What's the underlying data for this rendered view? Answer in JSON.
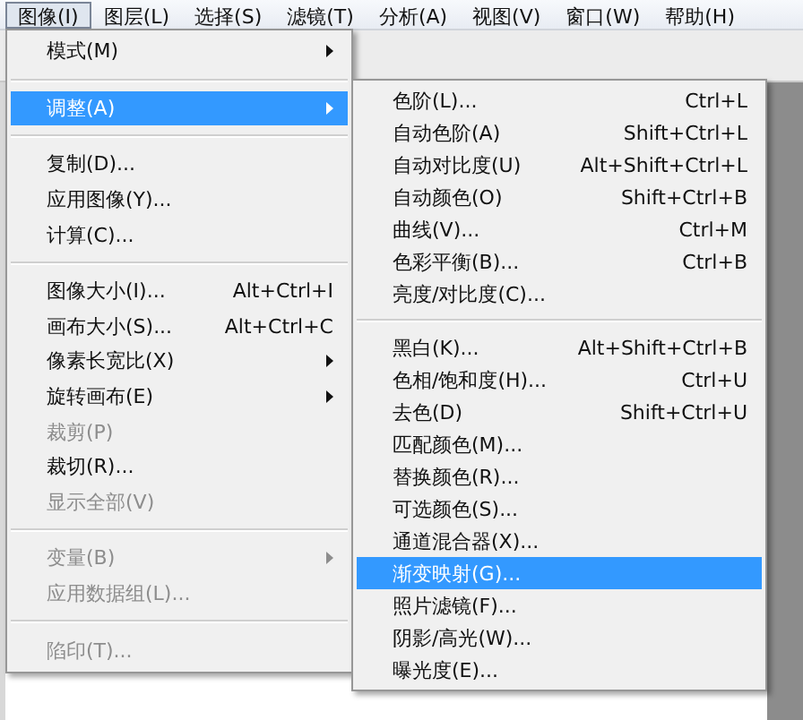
{
  "menubar": [
    {
      "label": "图像(I)",
      "selected": true
    },
    {
      "label": "图层(L)",
      "selected": false
    },
    {
      "label": "选择(S)",
      "selected": false
    },
    {
      "label": "滤镜(T)",
      "selected": false
    },
    {
      "label": "分析(A)",
      "selected": false
    },
    {
      "label": "视图(V)",
      "selected": false
    },
    {
      "label": "窗口(W)",
      "selected": false
    },
    {
      "label": "帮助(H)",
      "selected": false
    }
  ],
  "image_menu": [
    {
      "kind": "item",
      "label": "模式(M)",
      "submenu": true,
      "selected": false,
      "disabled": false
    },
    {
      "kind": "separator"
    },
    {
      "kind": "item",
      "label": "调整(A)",
      "submenu": true,
      "selected": true,
      "disabled": false
    },
    {
      "kind": "separator"
    },
    {
      "kind": "item",
      "label": "复制(D)...",
      "selected": false,
      "disabled": false
    },
    {
      "kind": "item",
      "label": "应用图像(Y)...",
      "selected": false,
      "disabled": false
    },
    {
      "kind": "item",
      "label": "计算(C)...",
      "selected": false,
      "disabled": false
    },
    {
      "kind": "separator"
    },
    {
      "kind": "item",
      "label": "图像大小(I)...",
      "shortcut": "Alt+Ctrl+I",
      "selected": false,
      "disabled": false
    },
    {
      "kind": "item",
      "label": "画布大小(S)...",
      "shortcut": "Alt+Ctrl+C",
      "selected": false,
      "disabled": false
    },
    {
      "kind": "item",
      "label": "像素长宽比(X)",
      "submenu": true,
      "selected": false,
      "disabled": false
    },
    {
      "kind": "item",
      "label": "旋转画布(E)",
      "submenu": true,
      "selected": false,
      "disabled": false
    },
    {
      "kind": "item",
      "label": "裁剪(P)",
      "selected": false,
      "disabled": true
    },
    {
      "kind": "item",
      "label": "裁切(R)...",
      "selected": false,
      "disabled": false
    },
    {
      "kind": "item",
      "label": "显示全部(V)",
      "selected": false,
      "disabled": true
    },
    {
      "kind": "separator"
    },
    {
      "kind": "item",
      "label": "变量(B)",
      "submenu": true,
      "selected": false,
      "disabled": true
    },
    {
      "kind": "item",
      "label": "应用数据组(L)...",
      "selected": false,
      "disabled": true
    },
    {
      "kind": "separator"
    },
    {
      "kind": "item",
      "label": "陷印(T)...",
      "selected": false,
      "disabled": true
    }
  ],
  "adjust_menu": [
    {
      "kind": "item",
      "label": "色阶(L)...",
      "shortcut": "Ctrl+L",
      "selected": false
    },
    {
      "kind": "item",
      "label": "自动色阶(A)",
      "shortcut": "Shift+Ctrl+L",
      "selected": false
    },
    {
      "kind": "item",
      "label": "自动对比度(U)",
      "shortcut": "Alt+Shift+Ctrl+L",
      "selected": false
    },
    {
      "kind": "item",
      "label": "自动颜色(O)",
      "shortcut": "Shift+Ctrl+B",
      "selected": false
    },
    {
      "kind": "item",
      "label": "曲线(V)...",
      "shortcut": "Ctrl+M",
      "selected": false
    },
    {
      "kind": "item",
      "label": "色彩平衡(B)...",
      "shortcut": "Ctrl+B",
      "selected": false
    },
    {
      "kind": "item",
      "label": "亮度/对比度(C)...",
      "selected": false
    },
    {
      "kind": "separator"
    },
    {
      "kind": "item",
      "label": "黑白(K)...",
      "shortcut": "Alt+Shift+Ctrl+B",
      "selected": false
    },
    {
      "kind": "item",
      "label": "色相/饱和度(H)...",
      "shortcut": "Ctrl+U",
      "selected": false
    },
    {
      "kind": "item",
      "label": "去色(D)",
      "shortcut": "Shift+Ctrl+U",
      "selected": false
    },
    {
      "kind": "item",
      "label": "匹配颜色(M)...",
      "selected": false
    },
    {
      "kind": "item",
      "label": "替换颜色(R)...",
      "selected": false
    },
    {
      "kind": "item",
      "label": "可选颜色(S)...",
      "selected": false
    },
    {
      "kind": "item",
      "label": "通道混合器(X)...",
      "selected": false
    },
    {
      "kind": "item",
      "label": "渐变映射(G)...",
      "selected": true
    },
    {
      "kind": "item",
      "label": "照片滤镜(F)...",
      "selected": false
    },
    {
      "kind": "item",
      "label": "阴影/高光(W)...",
      "selected": false
    },
    {
      "kind": "item",
      "label": "曝光度(E)...",
      "selected": false
    }
  ]
}
